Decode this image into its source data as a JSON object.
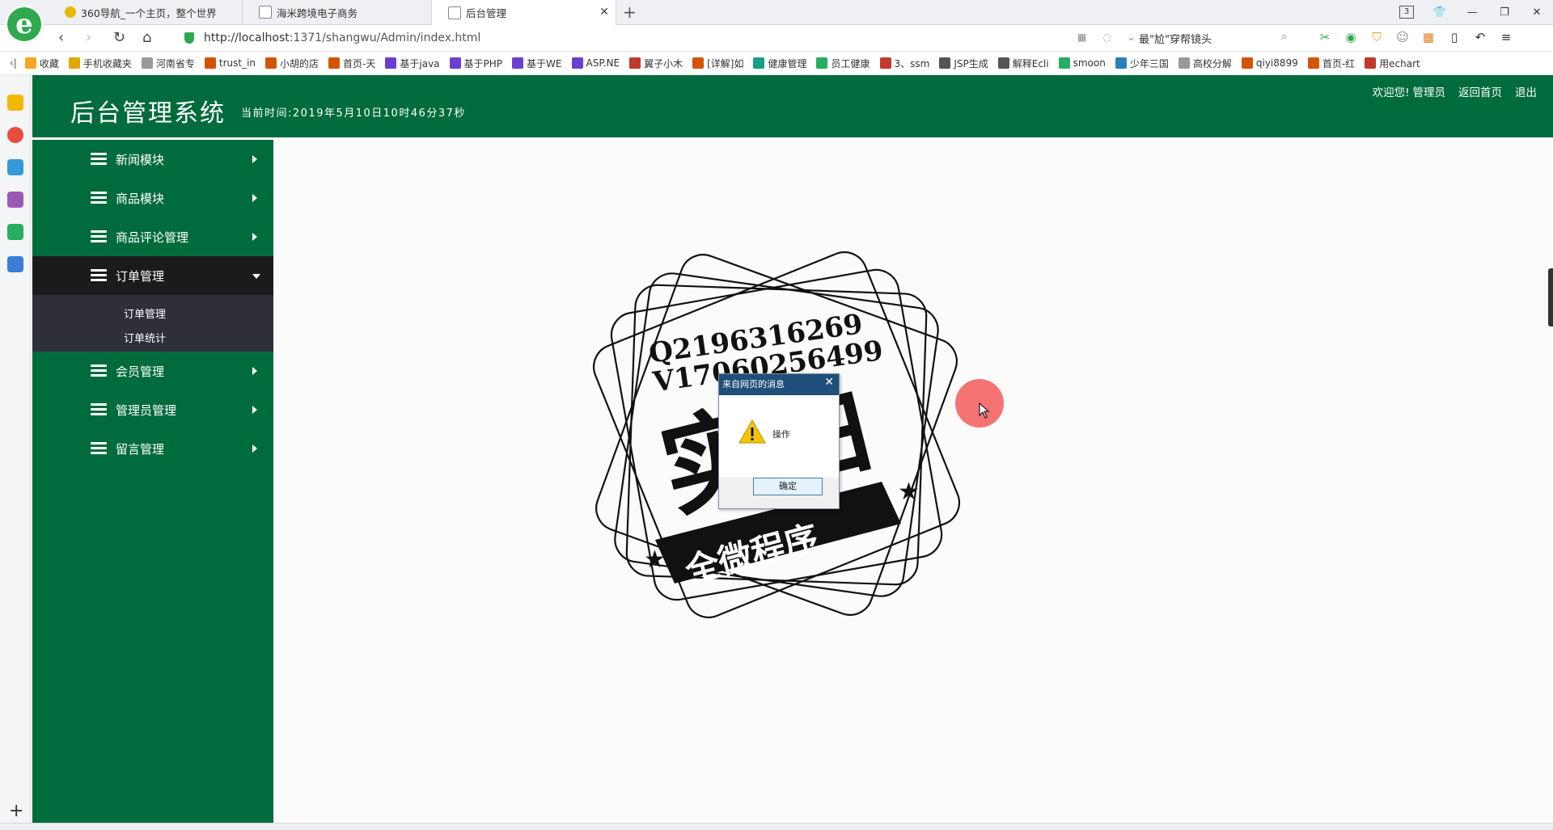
{
  "browser": {
    "tabs": [
      {
        "title": "360导航_一个主页，整个世界"
      },
      {
        "title": "海米跨境电子商务"
      },
      {
        "title": "后台管理"
      }
    ],
    "url_host": "http://localhost",
    "url_rest": ":1371/shangwu/Admin/index.html",
    "search_text": "最\"尬\"穿帮镜头",
    "tab_count": "3",
    "bookmarks": [
      {
        "label": "收藏",
        "color": "#f5a623"
      },
      {
        "label": "手机收藏夹",
        "color": "#e0a800"
      },
      {
        "label": "河南省专",
        "color": "#999999"
      },
      {
        "label": "trust_in",
        "color": "#d35400"
      },
      {
        "label": "小胡的店",
        "color": "#d35400"
      },
      {
        "label": "首页-天",
        "color": "#d35400"
      },
      {
        "label": "基于java",
        "color": "#6a3fd1"
      },
      {
        "label": "基于PHP",
        "color": "#6a3fd1"
      },
      {
        "label": "基于WE",
        "color": "#6a3fd1"
      },
      {
        "label": "ASP.NE",
        "color": "#6a3fd1"
      },
      {
        "label": "翼子小木",
        "color": "#c0392b"
      },
      {
        "label": "[详解]如",
        "color": "#d35400"
      },
      {
        "label": "健康管理",
        "color": "#16a085"
      },
      {
        "label": "员工健康",
        "color": "#27ae60"
      },
      {
        "label": "3、ssm",
        "color": "#c0392b"
      },
      {
        "label": "JSP生成",
        "color": "#555555"
      },
      {
        "label": "解释Ecli",
        "color": "#555555"
      },
      {
        "label": "smoon",
        "color": "#27ae60"
      },
      {
        "label": "少年三国",
        "color": "#2980b9"
      },
      {
        "label": "高校分解",
        "color": "#999999"
      },
      {
        "label": "qiyi8899",
        "color": "#d35400"
      },
      {
        "label": "首页-红",
        "color": "#d35400"
      },
      {
        "label": "用echart",
        "color": "#c0392b"
      }
    ]
  },
  "admin": {
    "title": "后台管理系统",
    "current_time": "当前时间:2019年5月10日10时46分37秒",
    "header_links": {
      "welcome": "欢迎您!",
      "user": "管理员",
      "home": "返回首页",
      "logout": "退出"
    },
    "menu": [
      {
        "label": "新闻模块",
        "open": false
      },
      {
        "label": "商品模块",
        "open": false
      },
      {
        "label": "商品评论管理",
        "open": false
      },
      {
        "label": "订单管理",
        "open": true
      },
      {
        "label": "会员管理",
        "open": false
      },
      {
        "label": "管理员管理",
        "open": false
      },
      {
        "label": "留言管理",
        "open": false
      }
    ],
    "submenu": [
      {
        "label": "订单管理"
      },
      {
        "label": "订单统计"
      }
    ]
  },
  "dialog": {
    "title": "来自网页的消息",
    "message": "操作",
    "ok_label": "确定"
  },
  "watermark": {
    "contact1": "Q2196316269",
    "contact2": "V17060256499",
    "big_text": "实拍",
    "banner_text": "全微程序"
  },
  "colors": {
    "brand_green": "#006b3c",
    "active_menu": "#1b1b1b",
    "submenu_bg": "#2f2f3a"
  }
}
